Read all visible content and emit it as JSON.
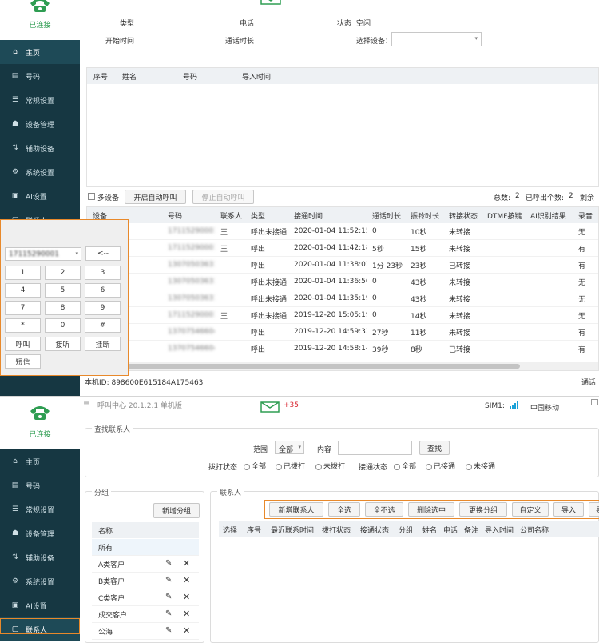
{
  "colors": {
    "sidebar": "#163742",
    "sidebar_active": "#1e4a57",
    "brand_green": "#2f9d52",
    "highlight": "#e8892b",
    "mail_badge": "#d9232e",
    "signal": "#1aa1d8"
  },
  "top": {
    "status_label": "已连接",
    "nav": [
      {
        "icon": "home-icon",
        "label": "主页"
      },
      {
        "icon": "number-icon",
        "label": "号码"
      },
      {
        "icon": "settings-icon",
        "label": "常规设置"
      },
      {
        "icon": "device-icon",
        "label": "设备管理"
      },
      {
        "icon": "aux-device-icon",
        "label": "辅助设备"
      },
      {
        "icon": "system-settings-icon",
        "label": "系统设置"
      },
      {
        "icon": "ai-icon",
        "label": "AI设置"
      },
      {
        "icon": "contacts-icon",
        "label": "联系人"
      }
    ],
    "info": {
      "type_label": "类型",
      "phone_label": "电话",
      "state_label": "状态",
      "state_value": "空闲",
      "start_label": "开始时间",
      "duration_label": "通话时长",
      "device_label": "选择设备："
    },
    "queue_headers": [
      "序号",
      "姓名",
      "号码",
      "导入时间"
    ],
    "toolbar": {
      "multi_device": "多设备",
      "start_auto": "开启自动呼叫",
      "stop_auto": "停止自动呼叫",
      "total_label": "总数:",
      "total_value": "2",
      "called_label": "已呼出个数:",
      "called_value": "2",
      "remaining_label": "剩余"
    },
    "call_headers": [
      "设备",
      "号码",
      "联系人",
      "类型",
      "接通时间",
      "通话时长",
      "振铃时长",
      "转接状态",
      "DTMF按键",
      "AI识别结果",
      "录音"
    ],
    "call_rows": [
      {
        "device": "90800178",
        "number": "17115290001",
        "contact": "王",
        "type": "呼出未接通",
        "time": "2020-01-04 11:52:15",
        "talk": "0",
        "ring": "10秒",
        "transfer": "未转接",
        "rec": "无"
      },
      {
        "device": "90800178",
        "number": "17115290001",
        "contact": "王",
        "type": "呼出",
        "time": "2020-01-04 11:42:18",
        "talk": "5秒",
        "ring": "15秒",
        "transfer": "未转接",
        "rec": "有"
      },
      {
        "device": "90800178",
        "number": "13070503631",
        "contact": "",
        "type": "呼出",
        "time": "2020-01-04 11:38:02",
        "talk": "1分 23秒",
        "ring": "23秒",
        "transfer": "已转接",
        "rec": "有"
      },
      {
        "device": "90800178",
        "number": "13070503631",
        "contact": "",
        "type": "呼出未接通",
        "time": "2020-01-04 11:36:50",
        "talk": "0",
        "ring": "43秒",
        "transfer": "未转接",
        "rec": "无"
      },
      {
        "device": "90800178",
        "number": "13070503631",
        "contact": "",
        "type": "呼出未接通",
        "time": "2020-01-04 11:35:19",
        "talk": "0",
        "ring": "43秒",
        "transfer": "未转接",
        "rec": "无"
      },
      {
        "device": "90800178",
        "number": "17115290001",
        "contact": "王",
        "type": "呼出未接通",
        "time": "2019-12-20 15:05:19",
        "talk": "0",
        "ring": "14秒",
        "transfer": "未转接",
        "rec": "无"
      },
      {
        "device": "90800178",
        "number": "13707546604",
        "contact": "",
        "type": "呼出",
        "time": "2019-12-20 14:59:32",
        "talk": "27秒",
        "ring": "11秒",
        "transfer": "未转接",
        "rec": "有"
      },
      {
        "device": "90800178",
        "number": "13707546604",
        "contact": "",
        "type": "呼出",
        "time": "2019-12-20 14:58:14",
        "talk": "39秒",
        "ring": "8秒",
        "transfer": "已转接",
        "rec": "有"
      }
    ],
    "footer": {
      "local_id": "本机ID:  898600E615184A175463",
      "right": "通话"
    }
  },
  "dialpad": {
    "number": "17115290001",
    "backspace": "<--",
    "keys": [
      "1",
      "2",
      "3",
      "4",
      "5",
      "6",
      "7",
      "8",
      "9",
      "*",
      "0",
      "#"
    ],
    "call": "呼叫",
    "answer": "接听",
    "hangup": "挂断",
    "sms": "短信"
  },
  "bottom": {
    "status_label": "已连接",
    "title": "呼叫中心  20.1.2.1  单机版",
    "mail_count": "+35",
    "sim_label": "SIM1:",
    "carrier": "中国移动",
    "nav": [
      {
        "icon": "home-icon",
        "label": "主页"
      },
      {
        "icon": "number-icon",
        "label": "号码"
      },
      {
        "icon": "settings-icon",
        "label": "常规设置"
      },
      {
        "icon": "device-icon",
        "label": "设备管理"
      },
      {
        "icon": "aux-device-icon",
        "label": "辅助设备"
      },
      {
        "icon": "system-settings-icon",
        "label": "系统设置"
      },
      {
        "icon": "ai-icon",
        "label": "AI设置"
      },
      {
        "icon": "contacts-icon",
        "label": "联系人"
      }
    ],
    "search": {
      "legend": "查找联系人",
      "range_label": "范围",
      "range_value": "全部",
      "content_label": "内容",
      "search_btn": "查找",
      "dial_state_label": "拨打状态",
      "dial_opts": [
        "全部",
        "已拨打",
        "未拨打"
      ],
      "conn_state_label": "接通状态",
      "conn_opts": [
        "全部",
        "已接通",
        "未接通"
      ]
    },
    "groups": {
      "legend": "分组",
      "add_btn": "新增分组",
      "header": "名称",
      "items": [
        "所有",
        "A类客户",
        "B类客户",
        "C类客户",
        "成交客户",
        "公海"
      ]
    },
    "contacts": {
      "legend": "联系人",
      "buttons": [
        "新增联系人",
        "全选",
        "全不选",
        "删除选中",
        "更换分组",
        "自定义",
        "导入",
        "导出"
      ],
      "headers": [
        "选择",
        "序号",
        "最近联系时间",
        "拨打状态",
        "接通状态",
        "分组",
        "姓名",
        "电话",
        "备注",
        "导入时间",
        "公司名称"
      ]
    }
  }
}
